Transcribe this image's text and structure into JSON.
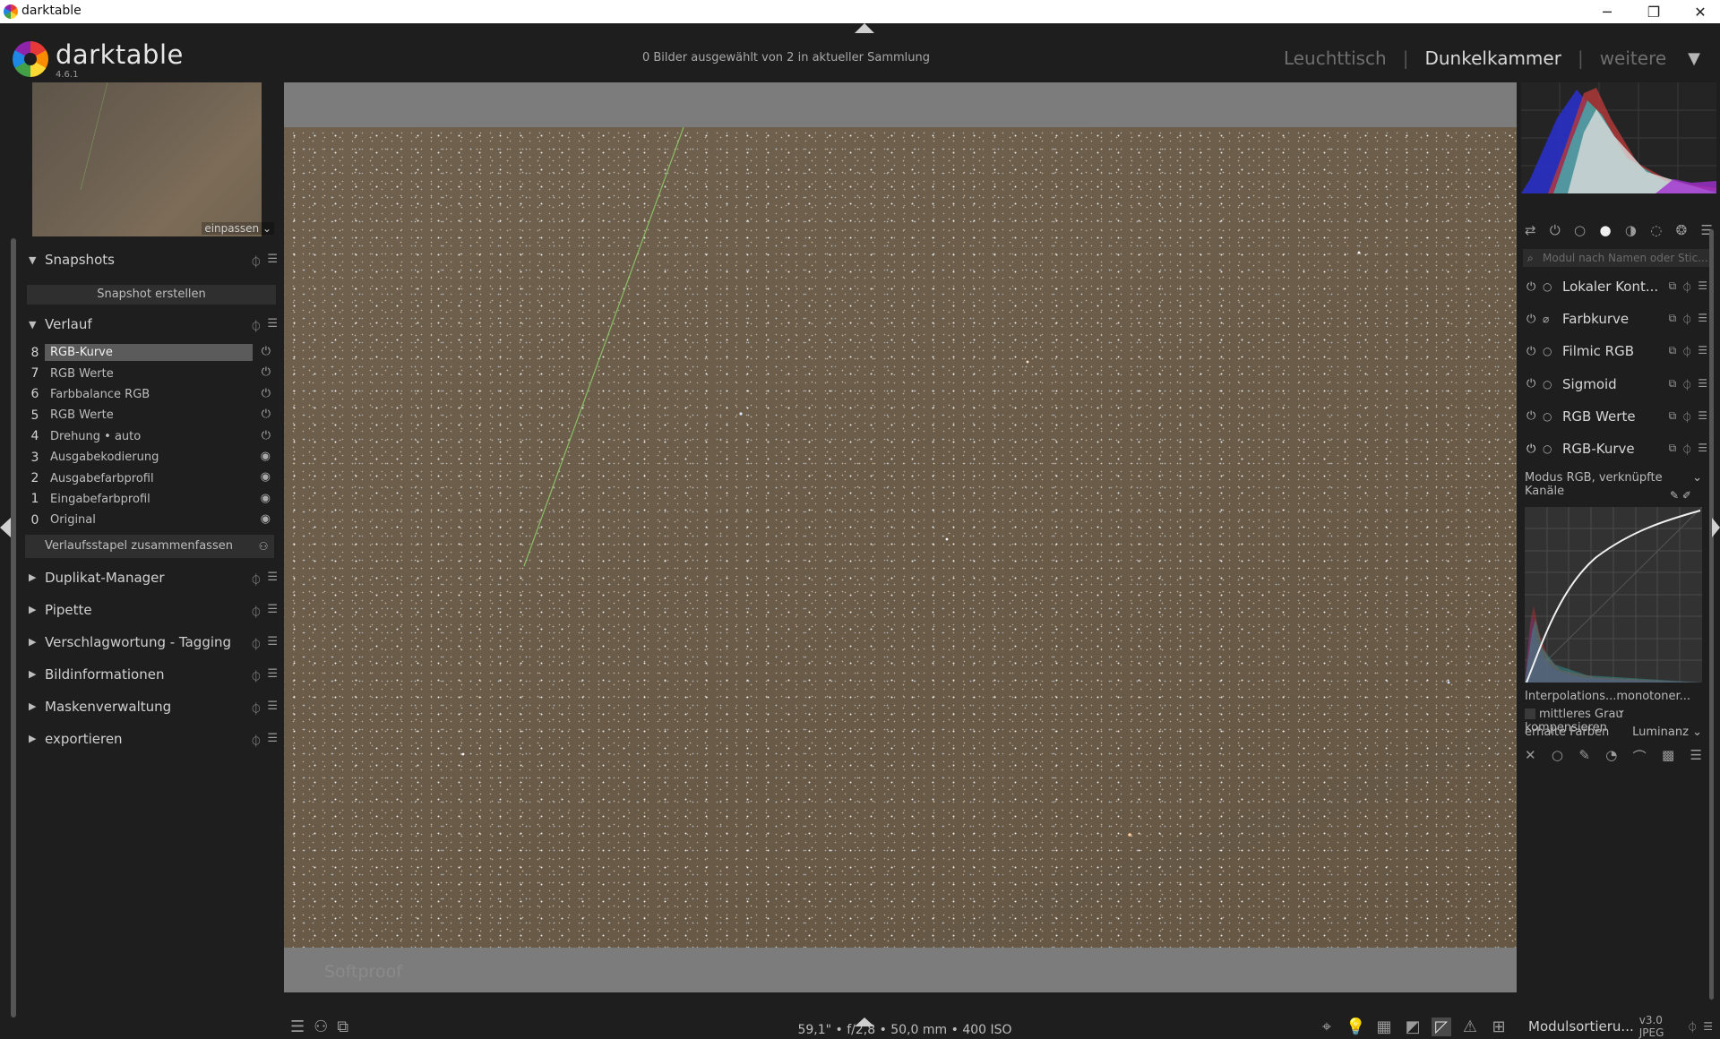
{
  "window": {
    "title": "darktable"
  },
  "header": {
    "brand": "darktable",
    "version": "4.6.1",
    "selection_info": "0 Bilder ausgewählt von 2 in aktueller Sammlung",
    "views": [
      "Leuchttisch",
      "Dunkelkammer",
      "weitere"
    ],
    "active_view": "Dunkelkammer"
  },
  "navigator": {
    "zoom_label": "einpassen"
  },
  "left_panel": {
    "snapshots": {
      "title": "Snapshots",
      "button": "Snapshot erstellen"
    },
    "history": {
      "title": "Verlauf",
      "items": [
        {
          "num": "8",
          "label": "RGB-Kurve",
          "selected": true
        },
        {
          "num": "7",
          "label": "RGB Werte"
        },
        {
          "num": "6",
          "label": "Farbbalance RGB"
        },
        {
          "num": "5",
          "label": "RGB Werte"
        },
        {
          "num": "4",
          "label": "Drehung • auto"
        },
        {
          "num": "3",
          "label": "Ausgabekodierung"
        },
        {
          "num": "2",
          "label": "Ausgabefarbprofil"
        },
        {
          "num": "1",
          "label": "Eingabefarbprofil"
        },
        {
          "num": "0",
          "label": "Original"
        }
      ],
      "compress_button": "Verlaufsstapel zusammenfassen"
    },
    "modules": [
      "Duplikat-Manager",
      "Pipette",
      "Verschlagwortung - Tagging",
      "Bildinformationen",
      "Maskenverwaltung",
      "exportieren"
    ]
  },
  "center": {
    "softproof_label": "Softproof",
    "exif": "59,1\" • f/2,8 • 50,0 mm • 400 ISO"
  },
  "right_panel": {
    "search_placeholder": "Modul nach Namen oder Stic...",
    "modules": [
      {
        "name": "Lokaler Kont..."
      },
      {
        "name": "Farbkurve"
      },
      {
        "name": "Filmic RGB"
      },
      {
        "name": "Sigmoid"
      },
      {
        "name": "RGB Werte"
      },
      {
        "name": "RGB-Kurve",
        "expanded": true
      }
    ],
    "rgb_curve": {
      "mode_label": "Modus RGB, verknüpfte Kanäle",
      "interp_label": "Interpolations...",
      "interp_value": "monotoner...",
      "preserve_gray_label": "mittleres Grau kompensieren",
      "preserve_colors_label": "erhalte Farben",
      "preserve_colors_value": "Luminanz"
    },
    "bottom": {
      "label": "Modulsortieru...",
      "version": "v3.0 JPEG"
    }
  },
  "colors": {
    "background": "#1e1e1e",
    "photo": "#6b5c48",
    "selected_history": "#5b5b5b",
    "meteor": "#8fd06a"
  }
}
